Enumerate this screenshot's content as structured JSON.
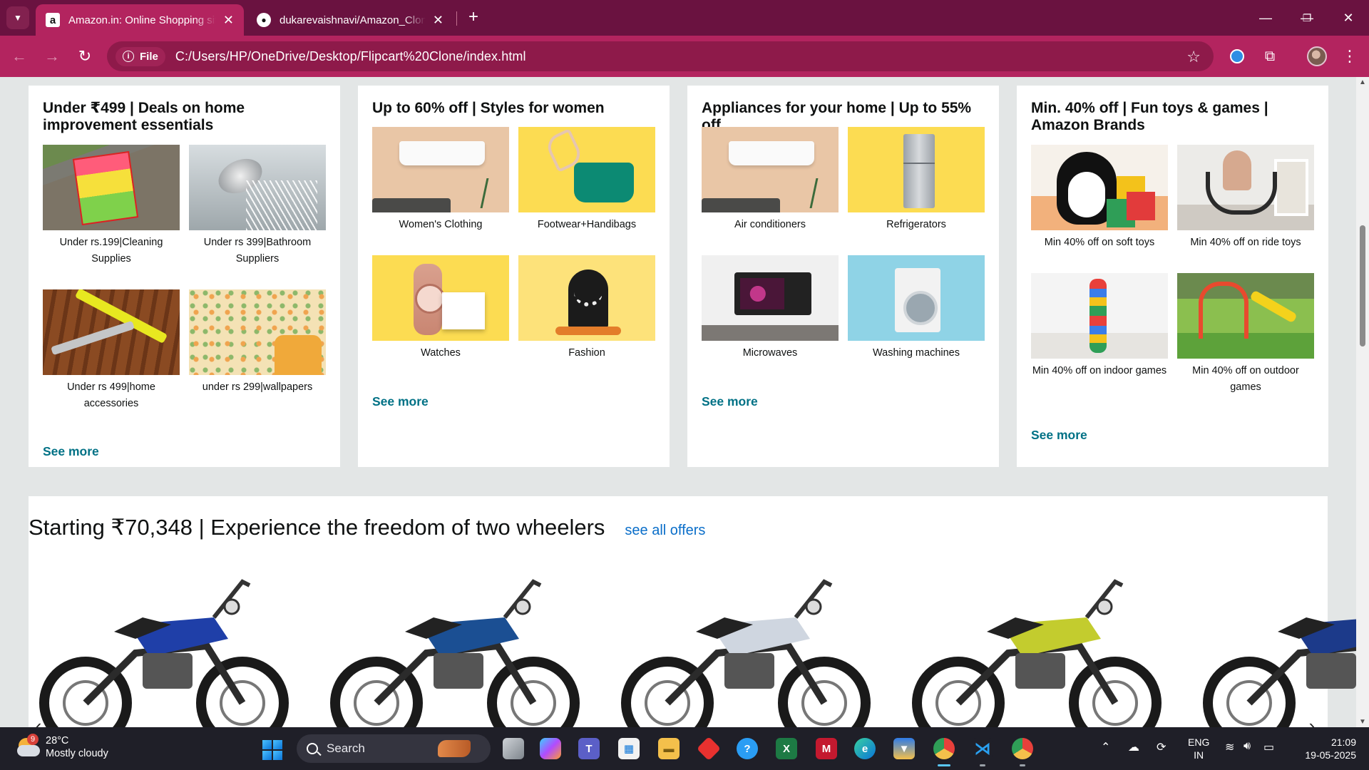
{
  "browser": {
    "tabs": [
      {
        "title": "Amazon.in: Online Shopping sit",
        "favicon": "amazon-a-icon",
        "active": true
      },
      {
        "title": "dukarevaishnavi/Amazon_Clone",
        "favicon": "github-icon",
        "active": false
      }
    ],
    "address": {
      "scheme_label": "File",
      "url": "C:/Users/HP/OneDrive/Desktop/Flipcart%20Clone/index.html"
    },
    "colors": {
      "tabbar": "#6a1240",
      "toolbar": "#b3245f",
      "omnibox": "#8e1a4a"
    }
  },
  "page": {
    "cards": [
      {
        "title": "Under ₹499 | Deals on home improvement essentials",
        "items": [
          {
            "caption": "Under rs.199|Cleaning Supplies"
          },
          {
            "caption": "Under rs 399|Bathroom Suppliers"
          },
          {
            "caption": "Under rs 499|home accessories"
          },
          {
            "caption": "under rs 299|wallpapers"
          }
        ],
        "see_more": "See more"
      },
      {
        "title": "Up to 60% off | Styles for women",
        "items": [
          {
            "caption": "Women's Clothing"
          },
          {
            "caption": "Footwear+Handibags"
          },
          {
            "caption": "Watches"
          },
          {
            "caption": "Fashion"
          }
        ],
        "see_more": "See more"
      },
      {
        "title": "Appliances for your home | Up to 55% off",
        "items": [
          {
            "caption": "Air conditioners"
          },
          {
            "caption": "Refrigerators"
          },
          {
            "caption": "Microwaves"
          },
          {
            "caption": "Washing machines"
          }
        ],
        "see_more": "See more"
      },
      {
        "title": "Min. 40% off | Fun toys & games | Amazon Brands",
        "items": [
          {
            "caption": "Min 40% off on soft toys"
          },
          {
            "caption": "Min 40% off on ride toys"
          },
          {
            "caption": "Min 40% off on indoor games"
          },
          {
            "caption": "Min 40% off on outdoor games"
          }
        ],
        "see_more": "See more"
      }
    ],
    "bikes": {
      "heading": "Starting ₹70,348 | Experience the freedom of two wheelers",
      "link": "see all offers",
      "prev_arrow": "‹",
      "next_arrow": "›",
      "bike_colors": [
        "#1f3fa8",
        "#1b4f93",
        "#cfd6e0",
        "#c3cc2e",
        "#1c3a8a"
      ]
    },
    "link_color": "#007185"
  },
  "taskbar": {
    "weather": {
      "temp": "28°C",
      "condition": "Mostly cloudy",
      "badge": "9"
    },
    "search_placeholder": "Search",
    "language": {
      "line1": "ENG",
      "line2": "IN"
    },
    "clock": {
      "time": "21:09",
      "date": "19-05-2025"
    }
  }
}
